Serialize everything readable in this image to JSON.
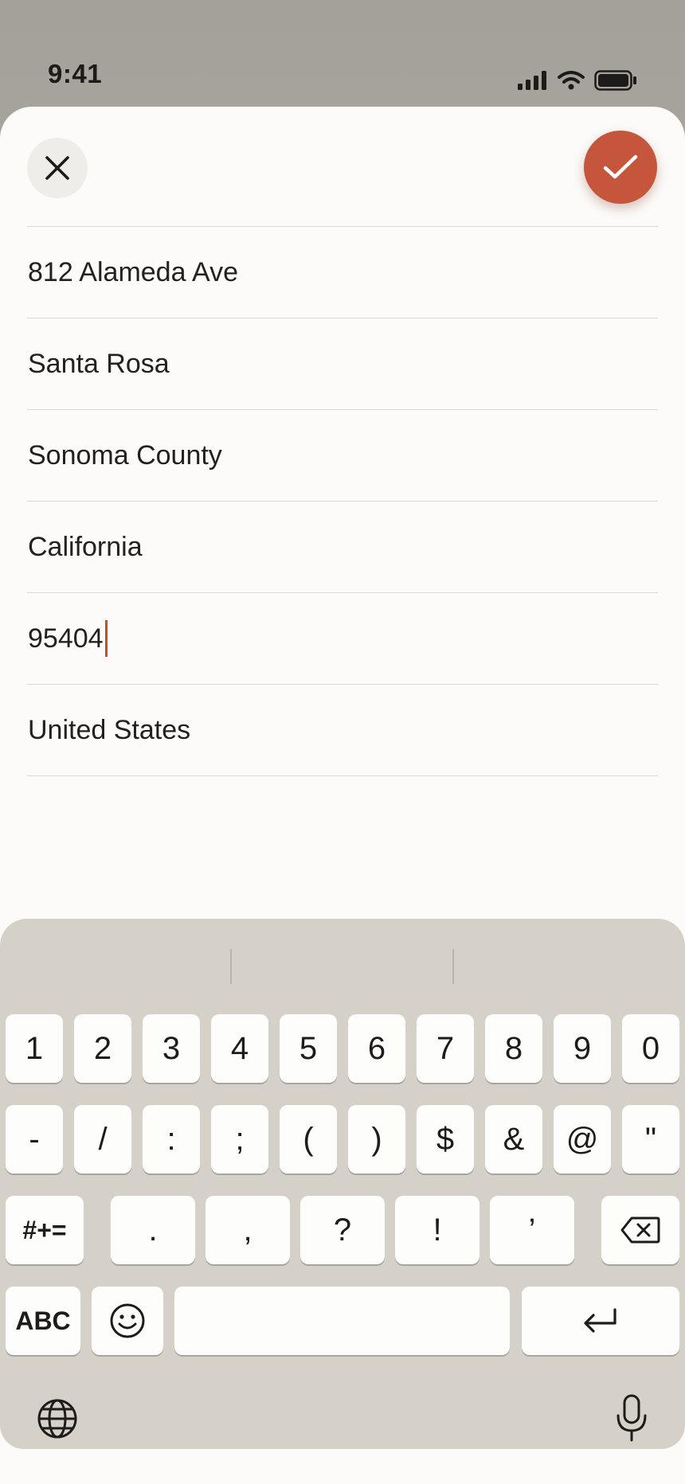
{
  "status_bar": {
    "time": "9:41"
  },
  "colors": {
    "accent": "#c5553b",
    "sheet": "#fcfbf9",
    "keyboard": "#d5d1c9"
  },
  "header": {
    "close_icon": "close-icon",
    "confirm_icon": "checkmark-icon"
  },
  "address_fields": [
    {
      "value": "812 Alameda Ave"
    },
    {
      "value": "Santa Rosa"
    },
    {
      "value": "Sonoma County"
    },
    {
      "value": "California"
    },
    {
      "value": "95404",
      "focused": true
    },
    {
      "value": "United States"
    }
  ],
  "keyboard": {
    "row1": [
      "1",
      "2",
      "3",
      "4",
      "5",
      "6",
      "7",
      "8",
      "9",
      "0"
    ],
    "row2": [
      "-",
      "/",
      ":",
      ";",
      "(",
      ")",
      "$",
      "&",
      "@",
      "\""
    ],
    "row3": {
      "shift": "#+=",
      "keys": [
        ".",
        ",",
        "?",
        "!",
        "’"
      ],
      "delete_icon": "backspace-icon"
    },
    "row4": {
      "abc": "ABC",
      "emoji_icon": "emoji-icon",
      "space": "",
      "return_icon": "return-icon"
    },
    "bottom": {
      "globe_icon": "globe-icon",
      "mic_icon": "microphone-icon"
    }
  }
}
